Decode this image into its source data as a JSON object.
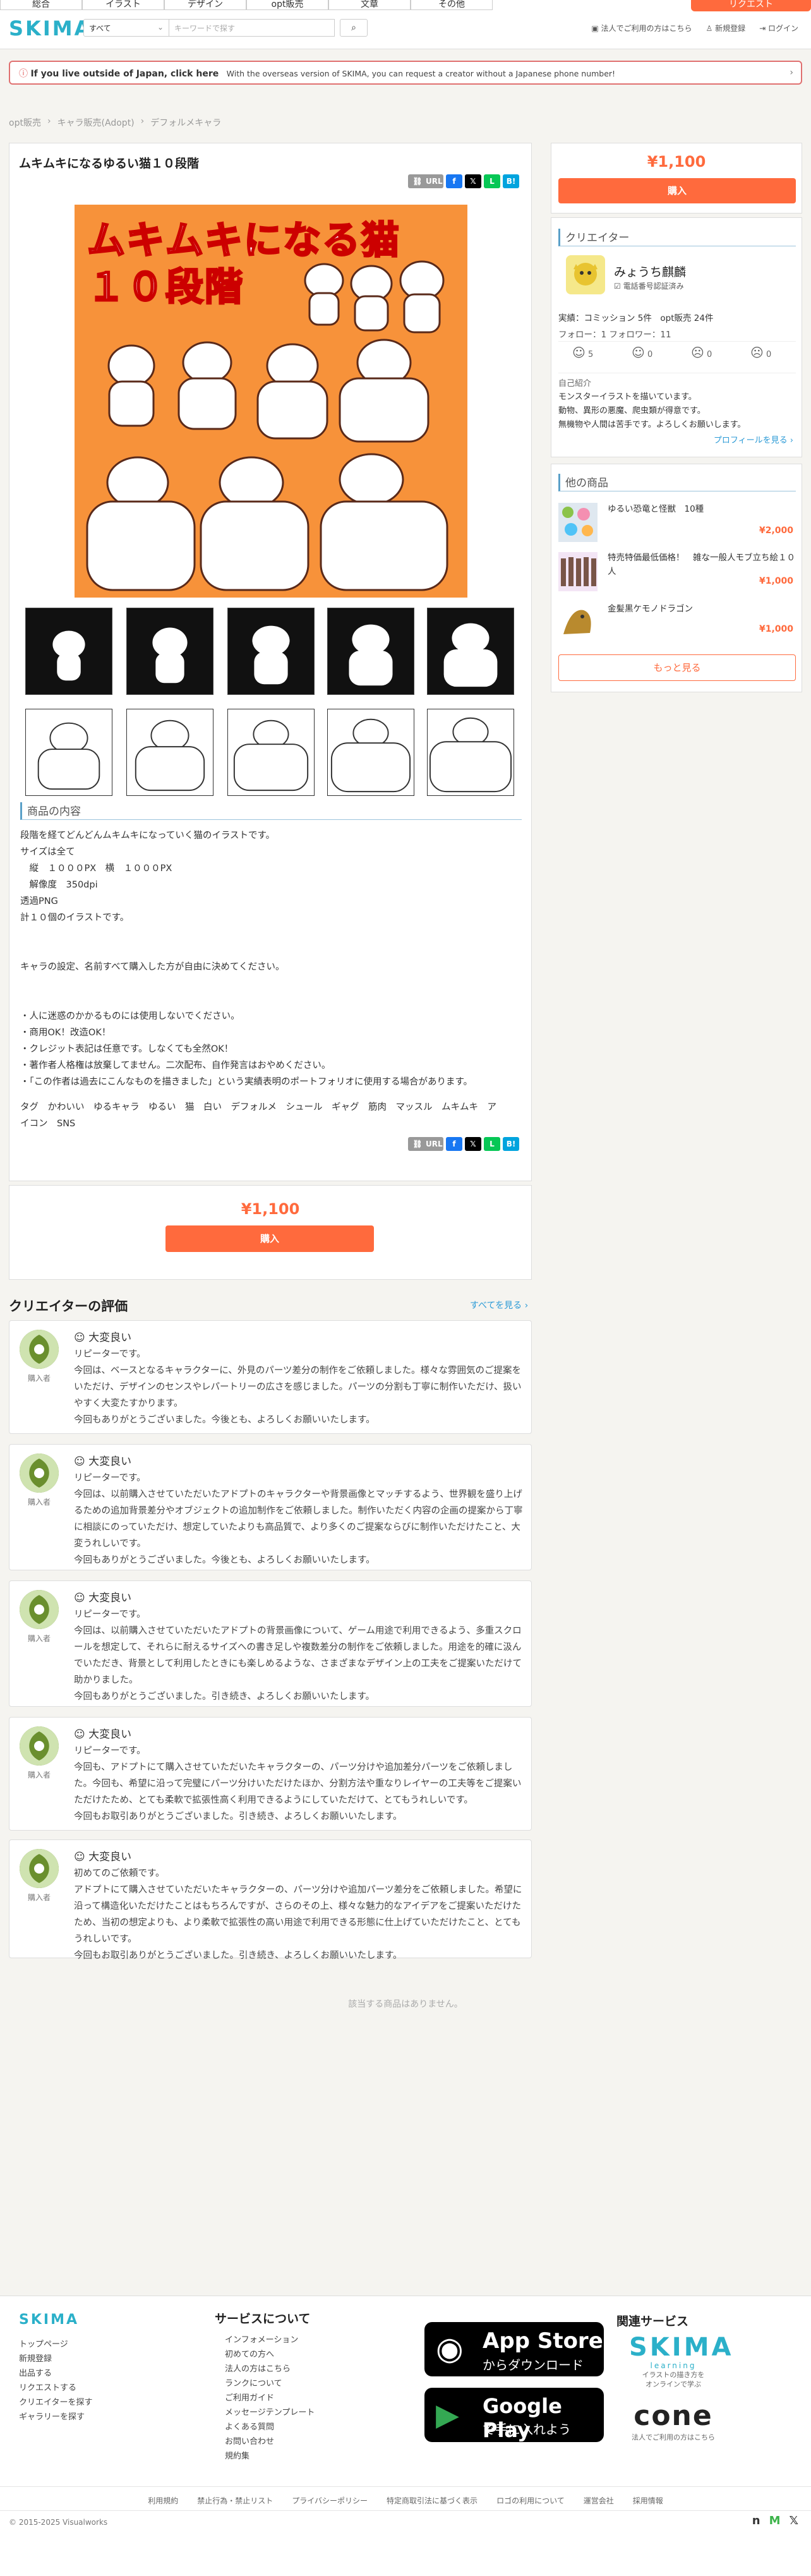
{
  "header": {
    "categories": [
      "総合",
      "イラスト",
      "デザイン",
      "opt販売",
      "文章",
      "その他"
    ],
    "request_label": "リクエスト",
    "logo": "SKIMA",
    "search_select": "すべて",
    "search_placeholder": "キーワードで探す",
    "links": [
      "法人でご利用の方はこちら",
      "新規登録",
      "ログイン"
    ]
  },
  "notice": {
    "bold": "If you live outside of Japan, click here",
    "text": "With the overseas version of SKIMA, you can request a creator without a Japanese phone number!"
  },
  "breadcrumbs": [
    "opt販売",
    "キャラ販売(Adopt)",
    "デフォルメキャラ"
  ],
  "product": {
    "title": "ムキムキになるゆるい猫１０段階",
    "image_title_line1": "ムキムキになる猫",
    "image_title_line2": "１０段階",
    "share_url": "URL",
    "section_title": "商品の内容",
    "description": "段階を経てどんどんムキムキになっていく猫のイラストです。\nサイズは全て\n　縦　１０００PX　横　１０００PX\n　解像度　350dpi\n透過PNG\n計１０個のイラストです。\n\n\nキャラの設定、名前すべて購入した方が自由に決めてください。\n\n\n・人に迷惑のかかるものには使用しないでください。\n・商用OK！改造OK！\n・クレジット表記は任意です。しなくても全然OK！\n・著作者人格権は放棄してません。二次配布、自作発言はおやめください。\n・「この作者は過去にこんなものを描きました」という実績表明のポートフォリオに使用する場合があります。",
    "tags": "タグ　かわいい　ゆるキャラ　ゆるい　猫　白い　デフォルメ　シュール　ギャグ　筋肉　マッスル　ムキムキ　ア\nイコン　SNS",
    "price": "¥1,100",
    "buy_label": "購入"
  },
  "creator": {
    "section_title": "クリエイター",
    "name": "みょうち麒麟",
    "verified": "電話番号認証済み",
    "stats": "実績：コミッション 5件　opt販売 24件",
    "follow": "フォロー：1 フォロワー：11",
    "ratings": [
      "5",
      "0",
      "0",
      "0"
    ],
    "intro_label": "自己紹介",
    "intro": "モンスターイラストを描いています。\n動物、異形の悪魔、爬虫類が得意です。\n無機物や人間は苦手です。よろしくお願いします。",
    "profile_link": "プロフィールを見る ›"
  },
  "other_products": {
    "section_title": "他の商品",
    "items": [
      {
        "name": "ゆるい恐竜と怪獣　10種",
        "price": "¥2,000"
      },
      {
        "name": "特売特価最低価格！　雑な一般人モブ立ち絵１０人",
        "price": "¥1,000"
      },
      {
        "name": "金髪黒ケモノドラゴン",
        "price": "¥1,000"
      }
    ],
    "more_label": "もっと見る"
  },
  "reviews": {
    "section_title": "クリエイターの評価",
    "see_all": "すべてを見る ›",
    "buyer_label": "購入者",
    "items": [
      {
        "rating": "大変良い",
        "text": "リピーターです。\n今回は、ベースとなるキャラクターに、外見のパーツ差分の制作をご依頼しました。様々な雰囲気のご提案をいただけ、デザインのセンスやレパートリーの広さを感じました。パーツの分割も丁寧に制作いただけ、扱いやすく大変たすかります。\n今回もありがとうございました。今後とも、よろしくお願いいたします。"
      },
      {
        "rating": "大変良い",
        "text": "リピーターです。\n今回は、以前購入させていただいたアドプトのキャラクターや背景画像とマッチするよう、世界観を盛り上げるための追加背景差分やオブジェクトの追加制作をご依頼しました。制作いただく内容の企画の提案から丁寧に相談にのっていただけ、想定していたよりも高品質で、より多くのご提案ならびに制作いただけたこと、大変うれしいです。\n今回もありがとうございました。今後とも、よろしくお願いいたします。"
      },
      {
        "rating": "大変良い",
        "text": "リピーターです。\n今回は、以前購入させていただいたアドプトの背景画像について、ゲーム用途で利用できるよう、多重スクロールを想定して、それらに耐えるサイズへの書き足しや複数差分の制作をご依頼しました。用途を的確に汲んでいただき、背景として利用したときにも楽しめるような、さまざまなデザイン上の工夫をご提案いただけて助かりました。\n今回もありがとうございました。引き続き、よろしくお願いいたします。"
      },
      {
        "rating": "大変良い",
        "text": "リピーターです。\n今回も、アドプトにて購入させていただいたキャラクターの、パーツ分けや追加差分パーツをご依頼しました。今回も、希望に沿って完璧にパーツ分けいただけたほか、分割方法や重なりレイヤーの工夫等をご提案いただけたため、とても柔軟で拡張性高く利用できるようにしていただけて、とてもうれしいです。\n今回もお取引ありがとうございました。引き続き、よろしくお願いいたします。"
      },
      {
        "rating": "大変良い",
        "text": "初めてのご依頼です。\nアドプトにて購入させていただいたキャラクターの、パーツ分けや追加パーツ差分をご依頼しました。希望に沿って構造化いただけたことはもちろんですが、さらのその上、様々な魅力的なアイデアをご提案いただけたため、当初の想定よりも、より柔軟で拡張性の高い用途で利用できる形態に仕上げていただけたこと、とてもうれしいです。\n今回もお取引ありがとうございました。引き続き、よろしくお願いいたします。"
      }
    ]
  },
  "related_empty": "該当する商品はありません。",
  "footer": {
    "logo": "SKIMA",
    "col1": [
      "トップページ",
      "新規登録",
      "出品する",
      "リクエストする",
      "クリエイターを探す",
      "ギャラリーを探す"
    ],
    "about_title": "サービスについて",
    "col2": [
      "インフォメーション",
      "初めての方へ",
      "法人の方はこちら",
      "ランクについて",
      "ご利用ガイド",
      "メッセージテンプレート",
      "よくある質問",
      "お問い合わせ",
      "規約集"
    ],
    "appstore_line1": "App Store",
    "appstore_line2": "からダウンロード",
    "googleplay_line1": "Google Play",
    "googleplay_line2": "で手に入れよう",
    "related_title": "関連サービス",
    "skima_learning": "SKIMA",
    "learning_sub": "learning",
    "learning_desc": "イラストの描き方を\nオンラインで学ぶ",
    "cone": "cone",
    "cone_desc": "法人でご利用の方はこちら",
    "bottom_links": [
      "利用規約",
      "禁止行為・禁止リスト",
      "プライバシーポリシー",
      "特定商取引法に基づく表示",
      "ロゴの利用について",
      "運営会社",
      "採用情報"
    ],
    "copyright": "© 2015-2025 Visualworks"
  },
  "colors": {
    "accent": "#ff6a3d",
    "brand": "#2bb0c9",
    "heading_bar": "#5aa0c8"
  }
}
